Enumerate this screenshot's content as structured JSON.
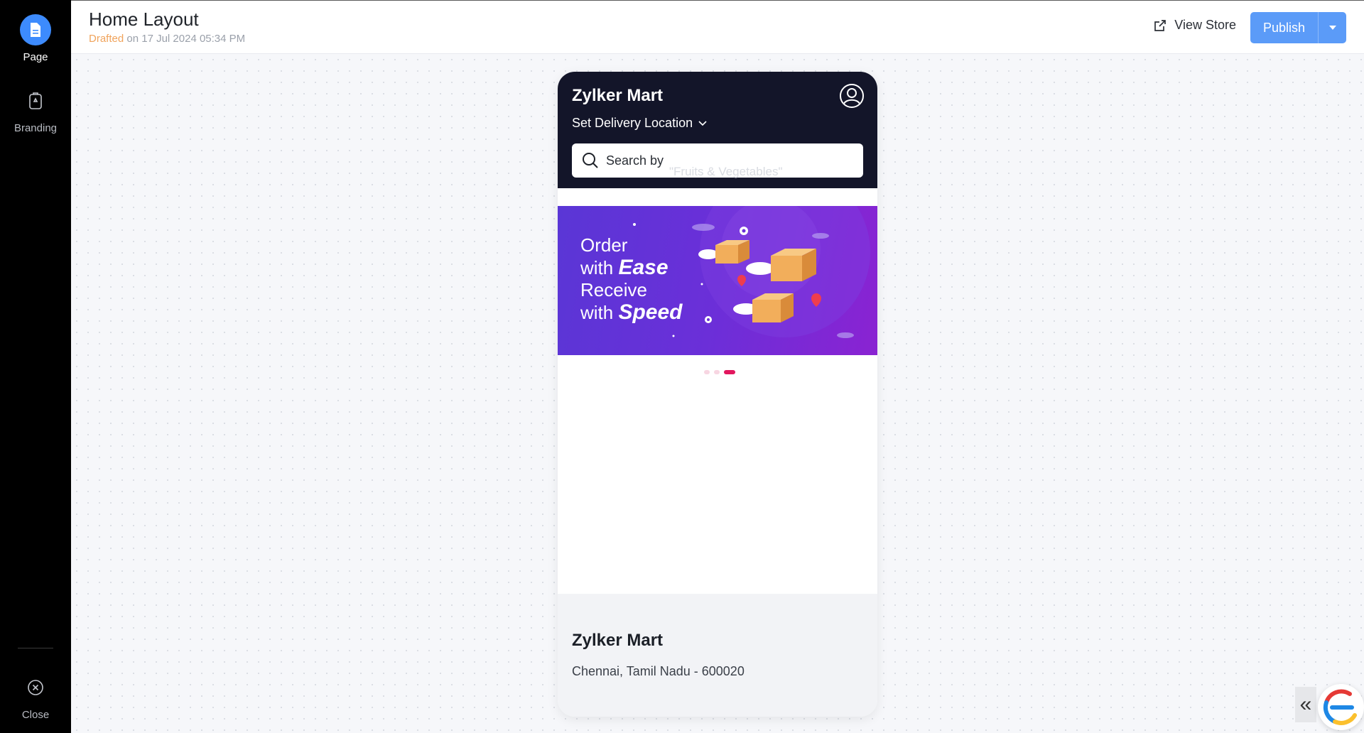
{
  "sidebar": {
    "items": [
      {
        "label": "Page",
        "icon": "page-icon",
        "active": true
      },
      {
        "label": "Branding",
        "icon": "branding-icon",
        "active": false
      }
    ],
    "close_label": "Close"
  },
  "header": {
    "title": "Home Layout",
    "status": "Drafted",
    "status_rest": " on 17 Jul 2024 05:34 PM",
    "view_store_label": "View Store",
    "publish_label": "Publish"
  },
  "preview": {
    "store_name": "Zylker Mart",
    "delivery_label": "Set Delivery Location",
    "search_placeholder": "Search by",
    "search_rotating_hint": "\"Fruits & Vegetables\"",
    "banner": {
      "line1": "Order",
      "line2_prefix": "with ",
      "line2_em": "Ease",
      "line3": "Receive",
      "line4_prefix": "with ",
      "line4_em": "Speed"
    },
    "carousel": {
      "count": 3,
      "active_index": 2
    },
    "footer": {
      "name": "Zylker Mart",
      "address": "Chennai, Tamil Nadu - 600020"
    }
  },
  "colors": {
    "accent": "#3d8bfd",
    "publish": "#5b9bf8",
    "draft_status": "#f0a35b",
    "phone_header": "#131529",
    "carousel_active": "#e2175e"
  }
}
